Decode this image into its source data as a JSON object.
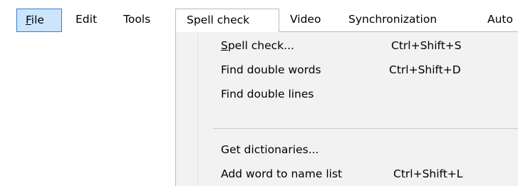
{
  "menubar": {
    "items": [
      {
        "label": "File",
        "mnemonic": "F",
        "rest": "ile",
        "state": "active"
      },
      {
        "label": "Edit"
      },
      {
        "label": "Tools"
      },
      {
        "label": "Spell check",
        "state": "open"
      },
      {
        "label": "Video"
      },
      {
        "label": "Synchronization"
      },
      {
        "label": "Auto"
      }
    ]
  },
  "spell_menu": {
    "items": [
      {
        "label": "Spell check...",
        "mnemonic": "S",
        "rest": "pell check...",
        "shortcut": "Ctrl+Shift+S"
      },
      {
        "label": "Find double words",
        "shortcut": "Ctrl+Shift+D"
      },
      {
        "label": "Find double lines",
        "shortcut": ""
      },
      {
        "label": "Get dictionaries...",
        "shortcut": ""
      },
      {
        "label": "Add word to name list",
        "shortcut": "Ctrl+Shift+L"
      }
    ]
  },
  "colors": {
    "active_fill": "#cce5ff",
    "active_border": "#2f7fd3",
    "dropdown_bg": "#f2f2f2",
    "dropdown_border": "#b9b9b9"
  }
}
